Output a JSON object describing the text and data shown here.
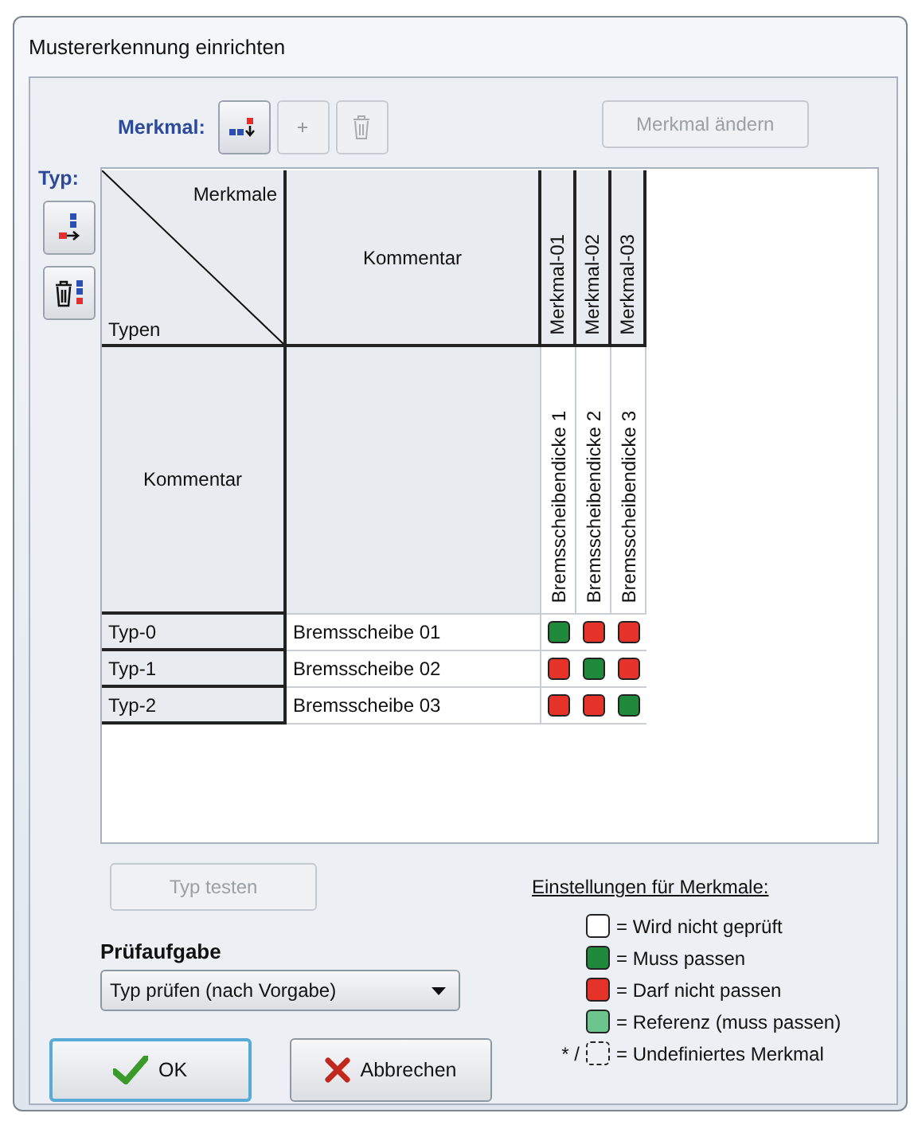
{
  "window": {
    "title": "Mustererkennung einrichten"
  },
  "merkmal_toolbar": {
    "label": "Merkmal:",
    "buttons": [
      {
        "kind": "add",
        "disabled": false
      },
      {
        "kind": "plus",
        "disabled": true
      },
      {
        "kind": "delete",
        "disabled": true
      }
    ],
    "edit_button": {
      "label": "Merkmal ändern",
      "disabled": true
    }
  },
  "typ_toolbar": {
    "label": "Typ:",
    "buttons": [
      {
        "kind": "add",
        "disabled": false
      },
      {
        "kind": "delete",
        "disabled": false
      }
    ]
  },
  "matrix": {
    "corner_top": "Merkmale",
    "corner_bottom": "Typen",
    "comment_header": "Kommentar",
    "comment_row_label": "Kommentar",
    "features": [
      {
        "name": "Merkmal-01",
        "comment": "Bremsscheibendicke 1"
      },
      {
        "name": "Merkmal-02",
        "comment": "Bremsscheibendicke 2"
      },
      {
        "name": "Merkmal-03",
        "comment": "Bremsscheibendicke 3"
      }
    ],
    "rows": [
      {
        "type": "Typ-0",
        "comment": "Bremsscheibe 01",
        "cells": [
          {
            "color": "#1f8a3c"
          },
          {
            "color": "#e5332a"
          },
          {
            "color": "#e5332a"
          }
        ]
      },
      {
        "type": "Typ-1",
        "comment": "Bremsscheibe 02",
        "cells": [
          {
            "color": "#e5332a"
          },
          {
            "color": "#1f8a3c"
          },
          {
            "color": "#e5332a"
          }
        ]
      },
      {
        "type": "Typ-2",
        "comment": "Bremsscheibe 03",
        "cells": [
          {
            "color": "#e5332a"
          },
          {
            "color": "#e5332a"
          },
          {
            "color": "#1f8a3c"
          }
        ]
      }
    ]
  },
  "test_button": {
    "label": "Typ testen",
    "disabled": true
  },
  "task": {
    "label": "Prüfaufgabe",
    "value": "Typ prüfen (nach Vorgabe)"
  },
  "buttons": [
    {
      "kind": "ok",
      "label": "OK"
    },
    {
      "kind": "cancel",
      "label": "Abbrechen"
    }
  ],
  "legend": {
    "title": "Einstellungen für Merkmale:",
    "items": [
      {
        "kind": "swatch",
        "color": "#ffffff",
        "text": "= Wird nicht geprüft"
      },
      {
        "kind": "swatch",
        "color": "#1f8a3c",
        "text": "= Muss passen"
      },
      {
        "kind": "swatch",
        "color": "#e5332a",
        "text": "= Darf nicht passen"
      },
      {
        "kind": "swatch",
        "color": "#6cc58c",
        "text": "= Referenz (muss passen)"
      },
      {
        "kind": "dashed",
        "prefix": "* /",
        "text": "= Undefiniertes Merkmal"
      }
    ]
  }
}
